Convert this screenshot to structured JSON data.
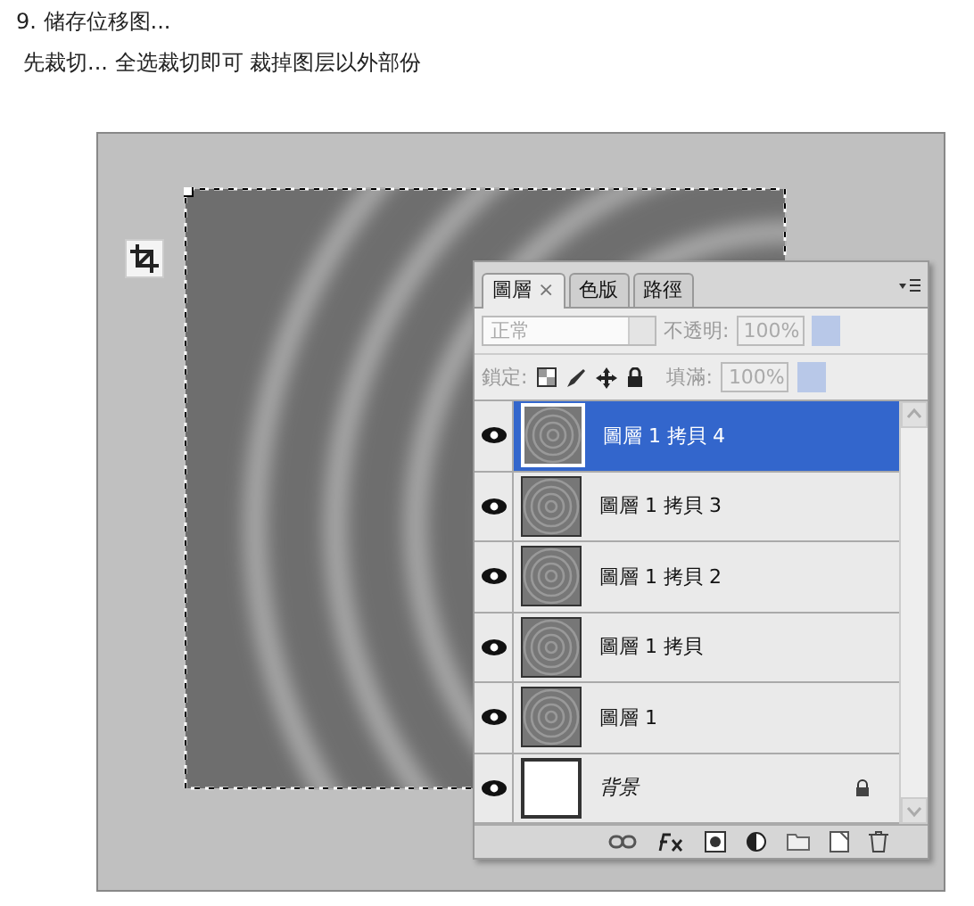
{
  "heading": "9. 储存位移图...",
  "subheading": "先裁切... 全选裁切即可 裁掉图层以外部份",
  "panel": {
    "tabs": [
      {
        "label": "圖層",
        "close": "×",
        "selected": true
      },
      {
        "label": "色版",
        "selected": false
      },
      {
        "label": "路徑",
        "selected": false
      }
    ],
    "blend_mode": {
      "value": "正常",
      "disabled": true
    },
    "opacity": {
      "label": "不透明:",
      "value": "100%",
      "disabled": true
    },
    "lock_label": "鎖定:",
    "fill": {
      "label": "填滿:",
      "value": "100%",
      "disabled": true
    },
    "layers": [
      {
        "name": "圖層 1 拷貝 4",
        "kind": "layer",
        "visible": true,
        "selected": true
      },
      {
        "name": "圖層 1 拷貝 3",
        "kind": "layer",
        "visible": true,
        "selected": false
      },
      {
        "name": "圖層 1 拷貝 2",
        "kind": "layer",
        "visible": true,
        "selected": false
      },
      {
        "name": "圖層 1 拷貝",
        "kind": "layer",
        "visible": true,
        "selected": false
      },
      {
        "name": "圖層 1",
        "kind": "layer",
        "visible": true,
        "selected": false
      },
      {
        "name": "背景",
        "kind": "background",
        "visible": true,
        "selected": false
      }
    ]
  }
}
